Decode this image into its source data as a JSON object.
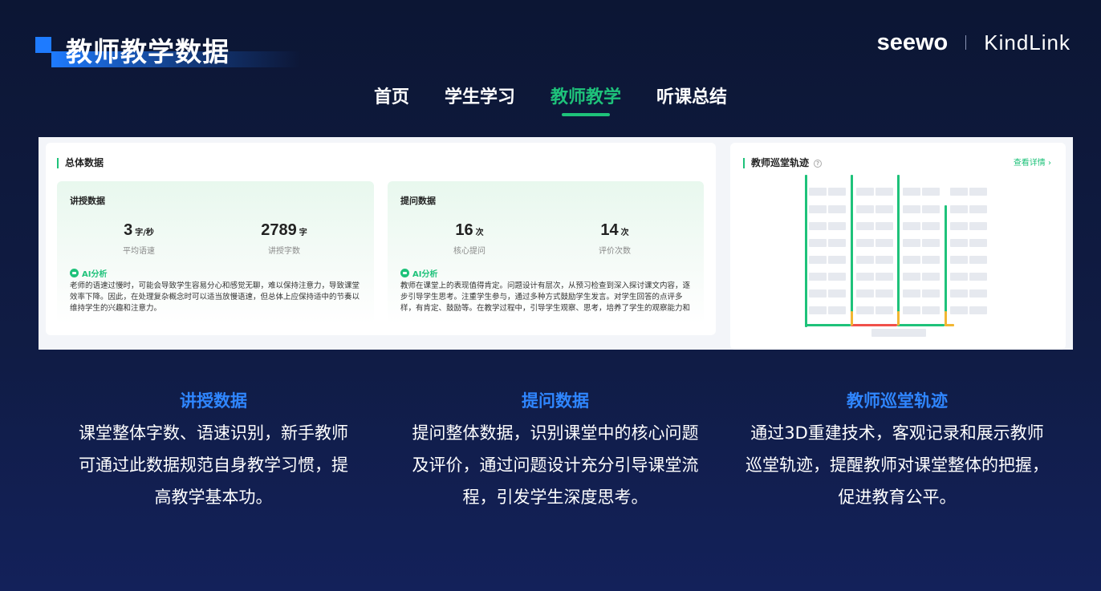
{
  "header": {
    "title": "教师教学数据",
    "brand_left": "seewo",
    "brand_right": "KindLink"
  },
  "nav": {
    "tabs": [
      {
        "label": "首页",
        "active": false
      },
      {
        "label": "学生学习",
        "active": false
      },
      {
        "label": "教师教学",
        "active": true
      },
      {
        "label": "听课总结",
        "active": false
      }
    ]
  },
  "overview": {
    "title": "总体数据",
    "lecture": {
      "title": "讲授数据",
      "stats": [
        {
          "value": "3",
          "unit": "字/秒",
          "label": "平均语速"
        },
        {
          "value": "2789",
          "unit": "字",
          "label": "讲授字数"
        }
      ],
      "ai_label": "AI分析",
      "ai_text": "老师的语速过慢时，可能会导致学生容易分心和感觉无聊，难以保持注意力，导致课堂效率下降。因此，在处理复杂概念时可以适当放慢语速，但总体上应保持适中的节奏以维持学生的兴趣和注意力。"
    },
    "question": {
      "title": "提问数据",
      "stats": [
        {
          "value": "16",
          "unit": "次",
          "label": "核心提问"
        },
        {
          "value": "14",
          "unit": "次",
          "label": "评价次数"
        }
      ],
      "ai_label": "AI分析",
      "ai_text": "教师在课堂上的表现值得肯定。问题设计有层次，从预习检查到深入探讨课文内容，逐步引导学生思考。注重学生参与，通过多种方式鼓励学生发言。对学生回答的点评多样，有肯定、鼓励等。在教学过程中，引导学生观察、思考，培养了学生的观察能力和"
    }
  },
  "patrol": {
    "title": "教师巡堂轨迹",
    "help_icon": "help-circle-icon",
    "detail_link": "查看详情 ›"
  },
  "features": [
    {
      "title": "讲授数据",
      "desc": "课堂整体字数、语速识别，新手教师可通过此数据规范自身教学习惯，提高教学基本功。"
    },
    {
      "title": "提问数据",
      "desc": "提问整体数据，识别课堂中的核心问题及评价，通过问题设计充分引导课堂流程，引发学生深度思考。"
    },
    {
      "title": "教师巡堂轨迹",
      "desc": "通过3D重建技术，客观记录和展示教师巡堂轨迹，提醒教师对课堂整体的把握，促进教育公平。"
    }
  ],
  "colors": {
    "accent_green": "#1ec27a",
    "accent_blue": "#2f86ff",
    "track_yellow": "#f2b632",
    "track_red": "#f0504a"
  }
}
